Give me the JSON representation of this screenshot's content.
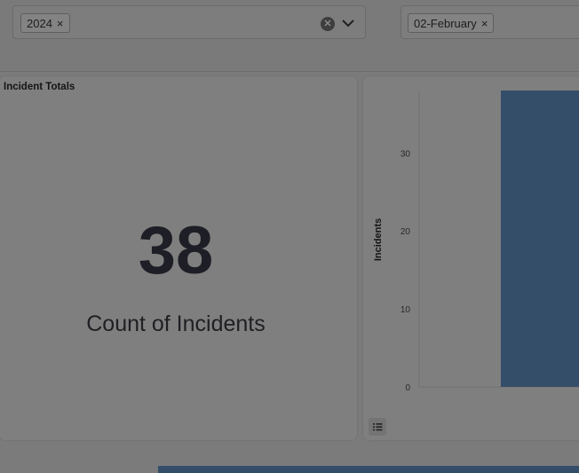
{
  "filters": {
    "year": {
      "tag_label": "2024",
      "remove_glyph": "×"
    },
    "month": {
      "tag_label": "02-February",
      "remove_glyph": "×"
    }
  },
  "totals_card": {
    "title": "Incident Totals",
    "value": "38",
    "label": "Count of Incidents"
  },
  "chart_data": {
    "type": "bar",
    "ylabel": "Incidents",
    "y_ticks": [
      "0",
      "10",
      "20",
      "30"
    ],
    "ylim": [
      0,
      38
    ],
    "values": [
      38
    ],
    "bar_color": "#344e6a"
  },
  "icons": {
    "clear": "clear-icon",
    "chevron": "chevron-down-icon",
    "list": "list-icon"
  }
}
